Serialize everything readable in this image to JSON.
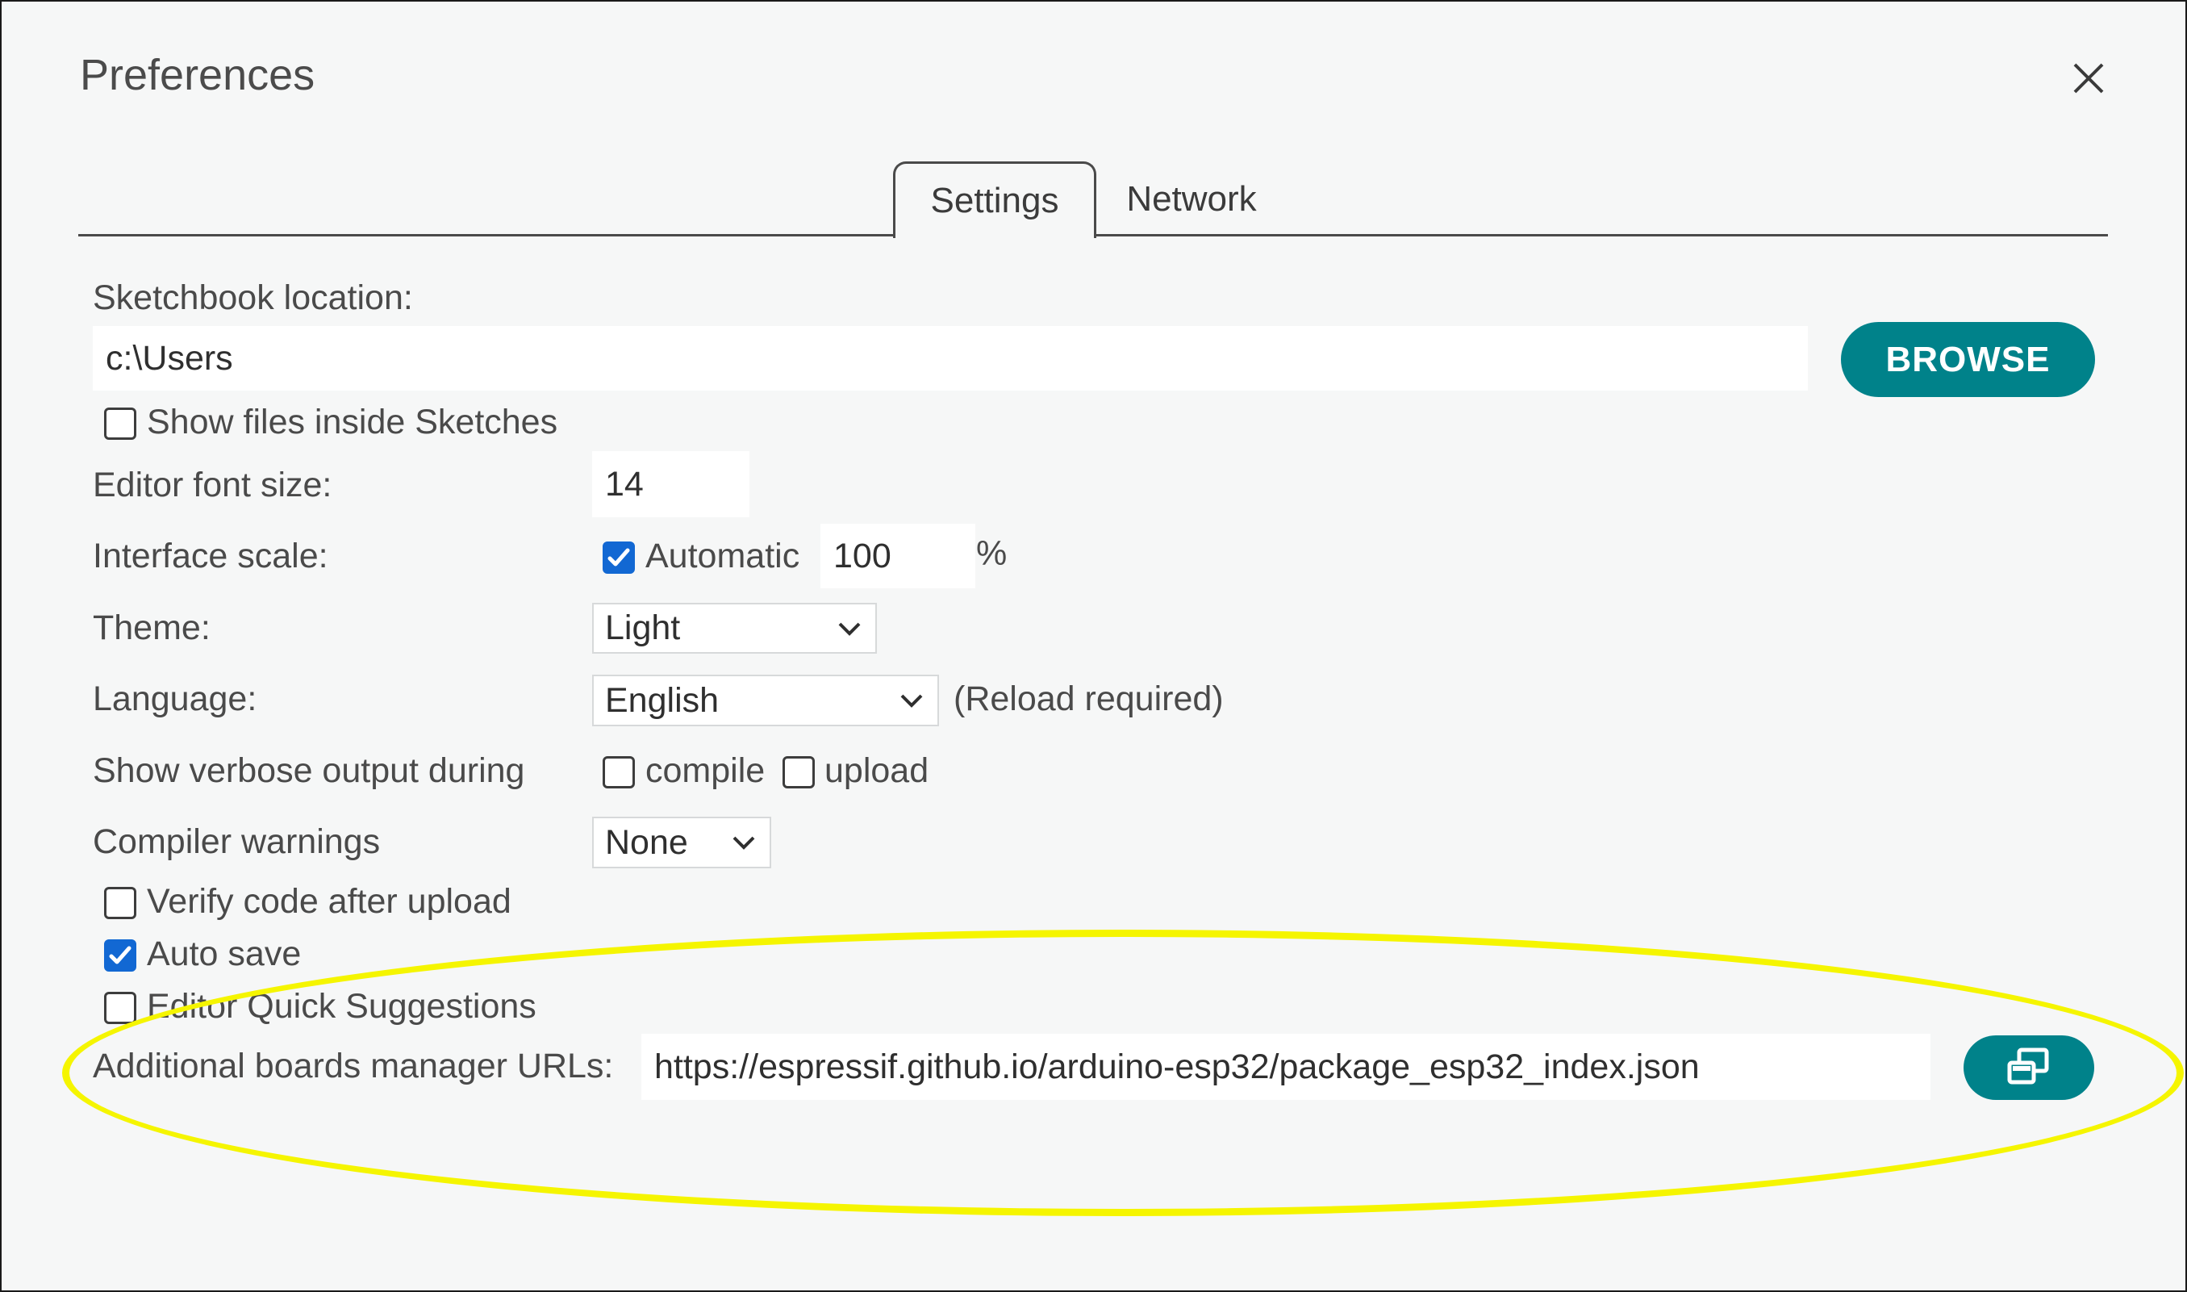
{
  "dialog": {
    "title": "Preferences",
    "close_icon": "close-icon"
  },
  "tabs": [
    {
      "label": "Settings",
      "active": true
    },
    {
      "label": "Network",
      "active": false
    }
  ],
  "settings": {
    "sketchbook": {
      "label": "Sketchbook location:",
      "value": "c:\\Users",
      "browse_label": "BROWSE"
    },
    "show_files": {
      "label": "Show files inside Sketches",
      "checked": false
    },
    "font_size": {
      "label": "Editor font size:",
      "value": "14"
    },
    "interface_scale": {
      "label": "Interface scale:",
      "automatic_label": "Automatic",
      "automatic_checked": true,
      "value": "100",
      "unit": "%"
    },
    "theme": {
      "label": "Theme:",
      "selected": "Light"
    },
    "language": {
      "label": "Language:",
      "selected": "English",
      "note": "(Reload required)"
    },
    "verbose": {
      "label": "Show verbose output during",
      "compile_label": "compile",
      "compile_checked": false,
      "upload_label": "upload",
      "upload_checked": false
    },
    "compiler_warnings": {
      "label": "Compiler warnings",
      "selected": "None"
    },
    "verify_code": {
      "label": "Verify code after upload",
      "checked": false
    },
    "auto_save": {
      "label": "Auto save",
      "checked": true
    },
    "quick_suggestions": {
      "label": "Editor Quick Suggestions",
      "checked": false
    },
    "boards_urls": {
      "label": "Additional boards manager URLs:",
      "value": "https://espressif.github.io/arduino-esp32/package_esp32_index.json",
      "button_icon": "open-window-icon"
    }
  },
  "colors": {
    "accent_teal": "#00828a",
    "checkbox_blue": "#1268d3",
    "highlight_yellow": "#f5f500",
    "dialog_background": "#f6f7f7"
  }
}
